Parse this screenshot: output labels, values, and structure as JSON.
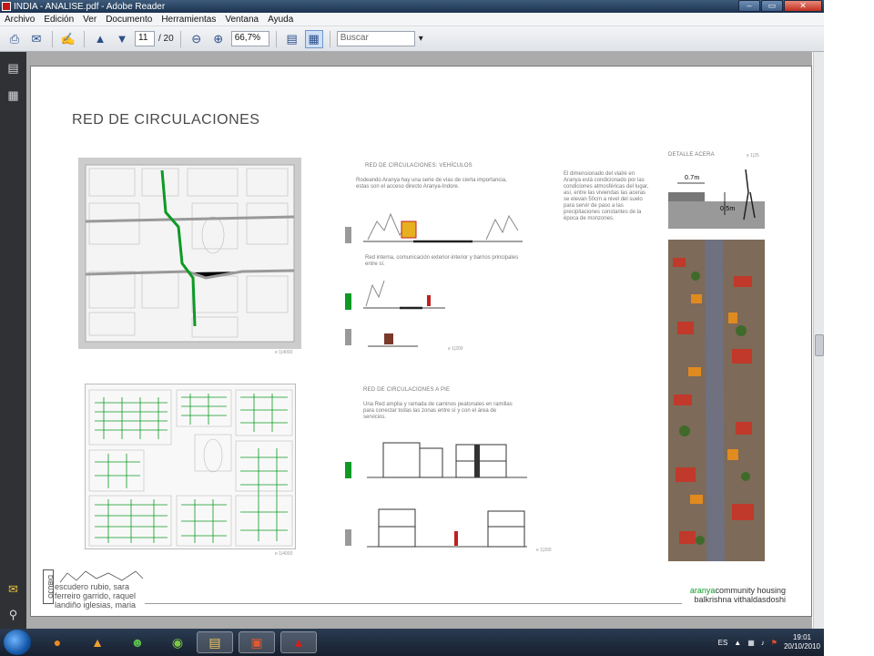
{
  "window": {
    "title": "INDIA - ANALISE.pdf - Adobe Reader",
    "controls": [
      "minimize",
      "maximize",
      "close"
    ]
  },
  "menu": [
    "Archivo",
    "Edición",
    "Ver",
    "Documento",
    "Herramientas",
    "Ventana",
    "Ayuda"
  ],
  "toolbar": {
    "current_page": "11",
    "total_pages": "/ 20",
    "zoom": "66,7%",
    "search_placeholder": "Buscar"
  },
  "document": {
    "title": "RED DE CIRCULACIONES",
    "vehicles_heading": "RED DE CIRCULACIONES: VEHÍCULOS",
    "vehicles_text": "Rodeando Aranya hay una serie de vías de cierta importancia, estas son el acceso directo Aranya-Indore.",
    "internal_text": "Red interna, comunicación exterior-interior y barrios principales entre sí.",
    "pedestrian_heading": "RED DE CIRCULACIONES A PIE",
    "pedestrian_text": "Una Red amplia y ramada de caminos peatonales en ramillas para conectar todas las zonas entre sí y con el área de servicios.",
    "climate_text": "El dimensionado del vial/e en Aranya está condicionado por las condiciones atmosféricas del lugar, así, entre las viviendas las aceras se elevan 50cm a nivel del suelo para servir de paso a las precipitaciones constantes de la época de monzones.",
    "detail_heading": "DETALLE ACERA",
    "detail_dim_1": "0.7m",
    "detail_dim_2": "0.5m",
    "scale_map1": "e 1|4000",
    "scale_map2": "e 1|4000",
    "scale_sections": "e 1|200",
    "scale_sections2": "e 1|200",
    "scale_detail": "e 1|25"
  },
  "footer": {
    "vertical_label": "DIBUJO",
    "authors": [
      "escudero rubio, sara",
      "ferreiro garrido, raquel",
      "landiño iglesias, maria"
    ],
    "project_line1": "aranya",
    "project_line1b": "community housing",
    "project_line2": "balkrishna vithaldasdoshi"
  },
  "taskbar": {
    "lang": "ES",
    "time": "19:01",
    "date": "20/10/2010",
    "apps": [
      "firefox-icon",
      "vlc-icon",
      "messenger-icon",
      "spotify-icon",
      "explorer-icon",
      "powerpoint-icon",
      "adobe-reader-icon"
    ]
  },
  "colors": {
    "accent_green": "#0c9a24",
    "titlebar": "#2c4766",
    "document_bg": "#ababab"
  }
}
